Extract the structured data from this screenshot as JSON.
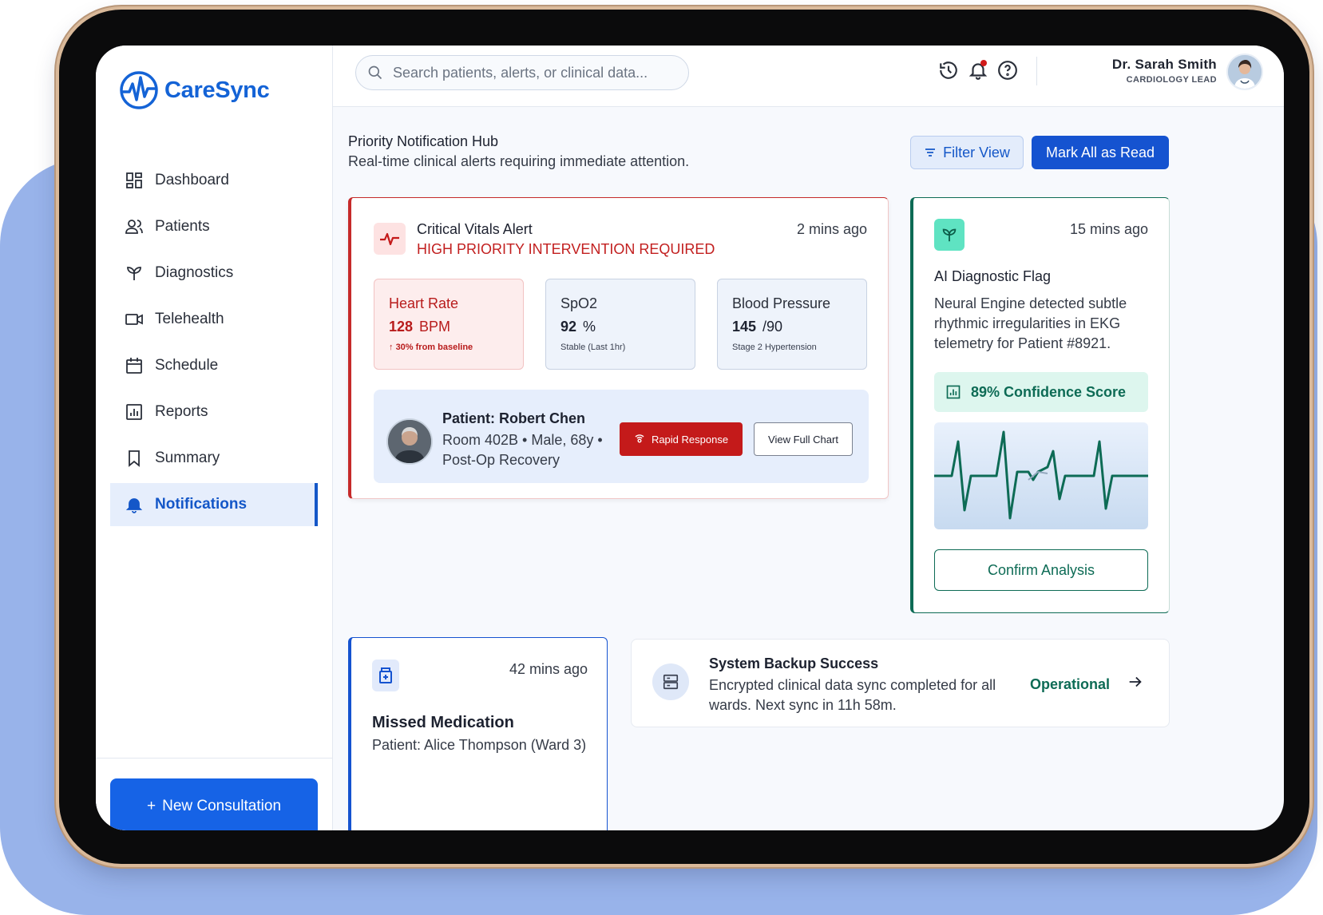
{
  "app": {
    "name": "CareSync"
  },
  "sidebar": {
    "items": [
      {
        "label": "Dashboard",
        "icon": "dashboard-icon"
      },
      {
        "label": "Patients",
        "icon": "patients-icon"
      },
      {
        "label": "Diagnostics",
        "icon": "diagnostics-icon"
      },
      {
        "label": "Telehealth",
        "icon": "video-icon"
      },
      {
        "label": "Schedule",
        "icon": "calendar-icon"
      },
      {
        "label": "Reports",
        "icon": "reports-icon"
      },
      {
        "label": "Summary",
        "icon": "bookmark-icon"
      },
      {
        "label": "Notifications",
        "icon": "bell-icon",
        "active": true
      }
    ],
    "new_consultation": "New Consultation"
  },
  "topbar": {
    "search_placeholder": "Search patients, alerts, or clinical data...",
    "user_name": "Dr. Sarah Smith",
    "user_role": "CARDIOLOGY LEAD"
  },
  "page": {
    "title": "Priority Notification Hub",
    "subtitle": "Real-time clinical alerts requiring immediate attention.",
    "filter_label": "Filter View",
    "mark_read_label": "Mark All as Read"
  },
  "critical": {
    "title": "Critical Vitals Alert",
    "subtitle": "HIGH PRIORITY INTERVENTION REQUIRED",
    "time": "2 mins ago",
    "vitals": [
      {
        "label": "Heart Rate",
        "value": "128",
        "unit": "BPM",
        "note": "30% from baseline"
      },
      {
        "label": "SpO2",
        "value": "92",
        "unit": "%",
        "note": "Stable (Last 1hr)"
      },
      {
        "label": "Blood Pressure",
        "value": "145",
        "unit": "/90",
        "note": "Stage 2 Hypertension"
      }
    ],
    "patient": {
      "name": "Patient: Robert Chen",
      "info": "Room 402B • Male, 68y • Post-Op Recovery"
    },
    "rapid_response": "Rapid Response",
    "view_chart": "View Full Chart"
  },
  "ai": {
    "time": "15 mins ago",
    "title": "AI Diagnostic Flag",
    "desc": "Neural Engine detected subtle rhythmic irregularities in EKG telemetry for Patient #8921.",
    "confidence": "89% Confidence Score",
    "confirm": "Confirm Analysis"
  },
  "medication": {
    "time": "42 mins ago",
    "title": "Missed Medication",
    "patient": "Patient: Alice Thompson (Ward 3)"
  },
  "backup": {
    "title": "System Backup Success",
    "desc": "Encrypted clinical data sync completed for all wards. Next sync in 11h 58m.",
    "status": "Operational"
  },
  "colors": {
    "primary": "#1553d0",
    "critical": "#c41a1a",
    "success": "#0d6b55",
    "backdrop": "#98b3ea"
  }
}
